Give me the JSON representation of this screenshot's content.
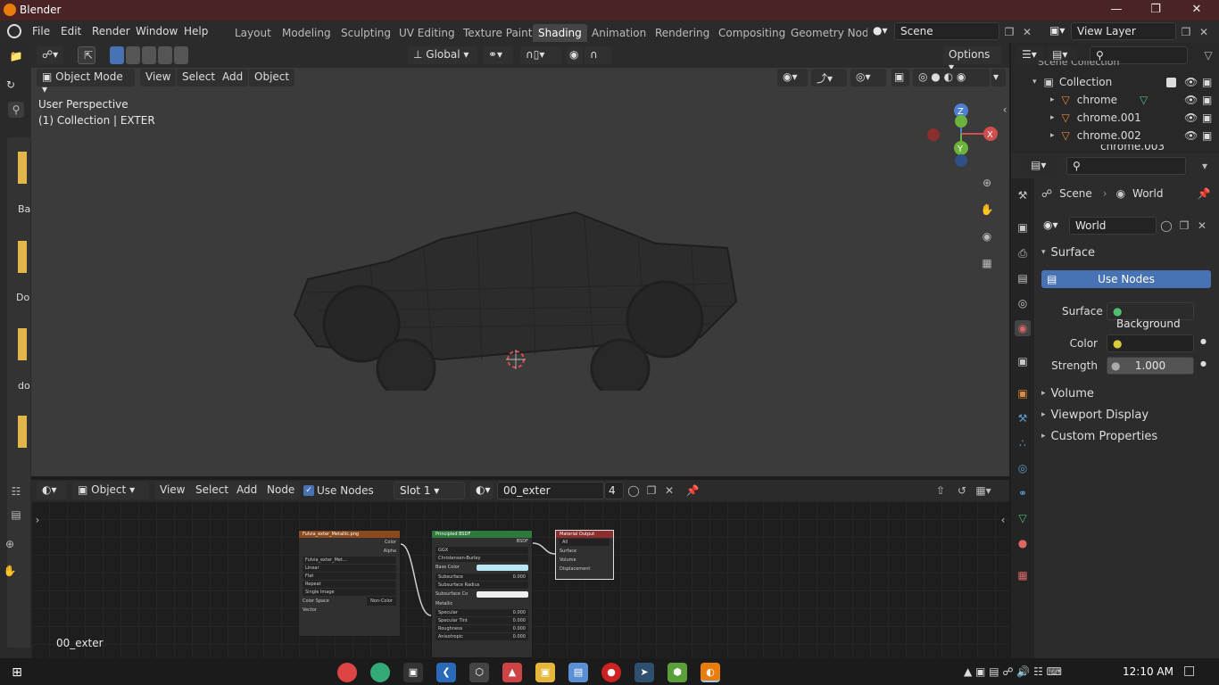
{
  "titlebar": {
    "title": "Blender"
  },
  "menubar": {
    "items": [
      "File",
      "Edit",
      "Render",
      "Window",
      "Help"
    ]
  },
  "workspaces": {
    "tabs": [
      "Layout",
      "Modeling",
      "Sculpting",
      "UV Editing",
      "Texture Paint",
      "Shading",
      "Animation",
      "Rendering",
      "Compositing",
      "Geometry Nod"
    ],
    "active": "Shading"
  },
  "scene": {
    "name": "Scene",
    "view_layer": "View Layer"
  },
  "viewport": {
    "mode": "Object Mode",
    "menus": [
      "View",
      "Select",
      "Add",
      "Object"
    ],
    "orientation": "Global",
    "options_label": "Options",
    "info_line1": "User Perspective",
    "info_line2": "(1) Collection | EXTER",
    "gizmo": {
      "x": "X",
      "y": "Y",
      "z": "Z"
    }
  },
  "outliner": {
    "header": "Scene Collection",
    "collection": "Collection",
    "items": [
      "chrome",
      "chrome.001",
      "chrome.002",
      "chrome.003"
    ]
  },
  "properties": {
    "breadcrumb_scene": "Scene",
    "breadcrumb_world": "World",
    "world_name": "World",
    "panel_surface": "Surface",
    "use_nodes": "Use Nodes",
    "surface_label": "Surface",
    "surface_value": "Background",
    "color_label": "Color",
    "strength_label": "Strength",
    "strength_value": "1.000",
    "panel_volume": "Volume",
    "panel_viewport_display": "Viewport Display",
    "panel_custom": "Custom Properties"
  },
  "node_editor": {
    "object_mode": "Object",
    "menus": [
      "View",
      "Select",
      "Add",
      "Node"
    ],
    "use_nodes": "Use Nodes",
    "slot": "Slot 1",
    "material": "00_exter",
    "user_count": "4",
    "footer_label": "00_exter"
  },
  "nodes": {
    "image": {
      "title": "Fulvia_exter_Metallic.png",
      "out_color": "Color",
      "out_alpha": "Alpha",
      "file": "Fulvia_exter_Met...",
      "interp": "Linear",
      "proj": "Flat",
      "ext": "Repeat",
      "src": "Single Image",
      "cs_label": "Color Space",
      "cs_value": "Non-Color",
      "vector": "Vector"
    },
    "bsdf": {
      "title": "Principled BSDF",
      "out": "BSDF",
      "dist": "GGX",
      "sss": "Christensen-Burley",
      "base": "Base Color",
      "subsurface": "Subsurface",
      "subsurface_val": "0.000",
      "ssradius": "Subsurface Radius",
      "sscolor": "Subsurface Co",
      "metallic": "Metallic",
      "specular": "Specular",
      "specular_val": "0.000",
      "spectint": "Specular Tint",
      "spectint_val": "0.000",
      "rough": "Roughness",
      "rough_val": "0.000",
      "aniso": "Anisotropic",
      "aniso_val": "0.000"
    },
    "output": {
      "title": "Material Output",
      "target": "All",
      "surface": "Surface",
      "volume": "Volume",
      "displacement": "Displacement"
    }
  },
  "left_panel": {
    "labels": [
      "Ba",
      "Do",
      "do"
    ]
  },
  "taskbar": {
    "time": "12:10 AM"
  },
  "colors": {
    "accent": "#4772b3",
    "titlebar": "#4a2424",
    "active_tab": "#454545"
  }
}
